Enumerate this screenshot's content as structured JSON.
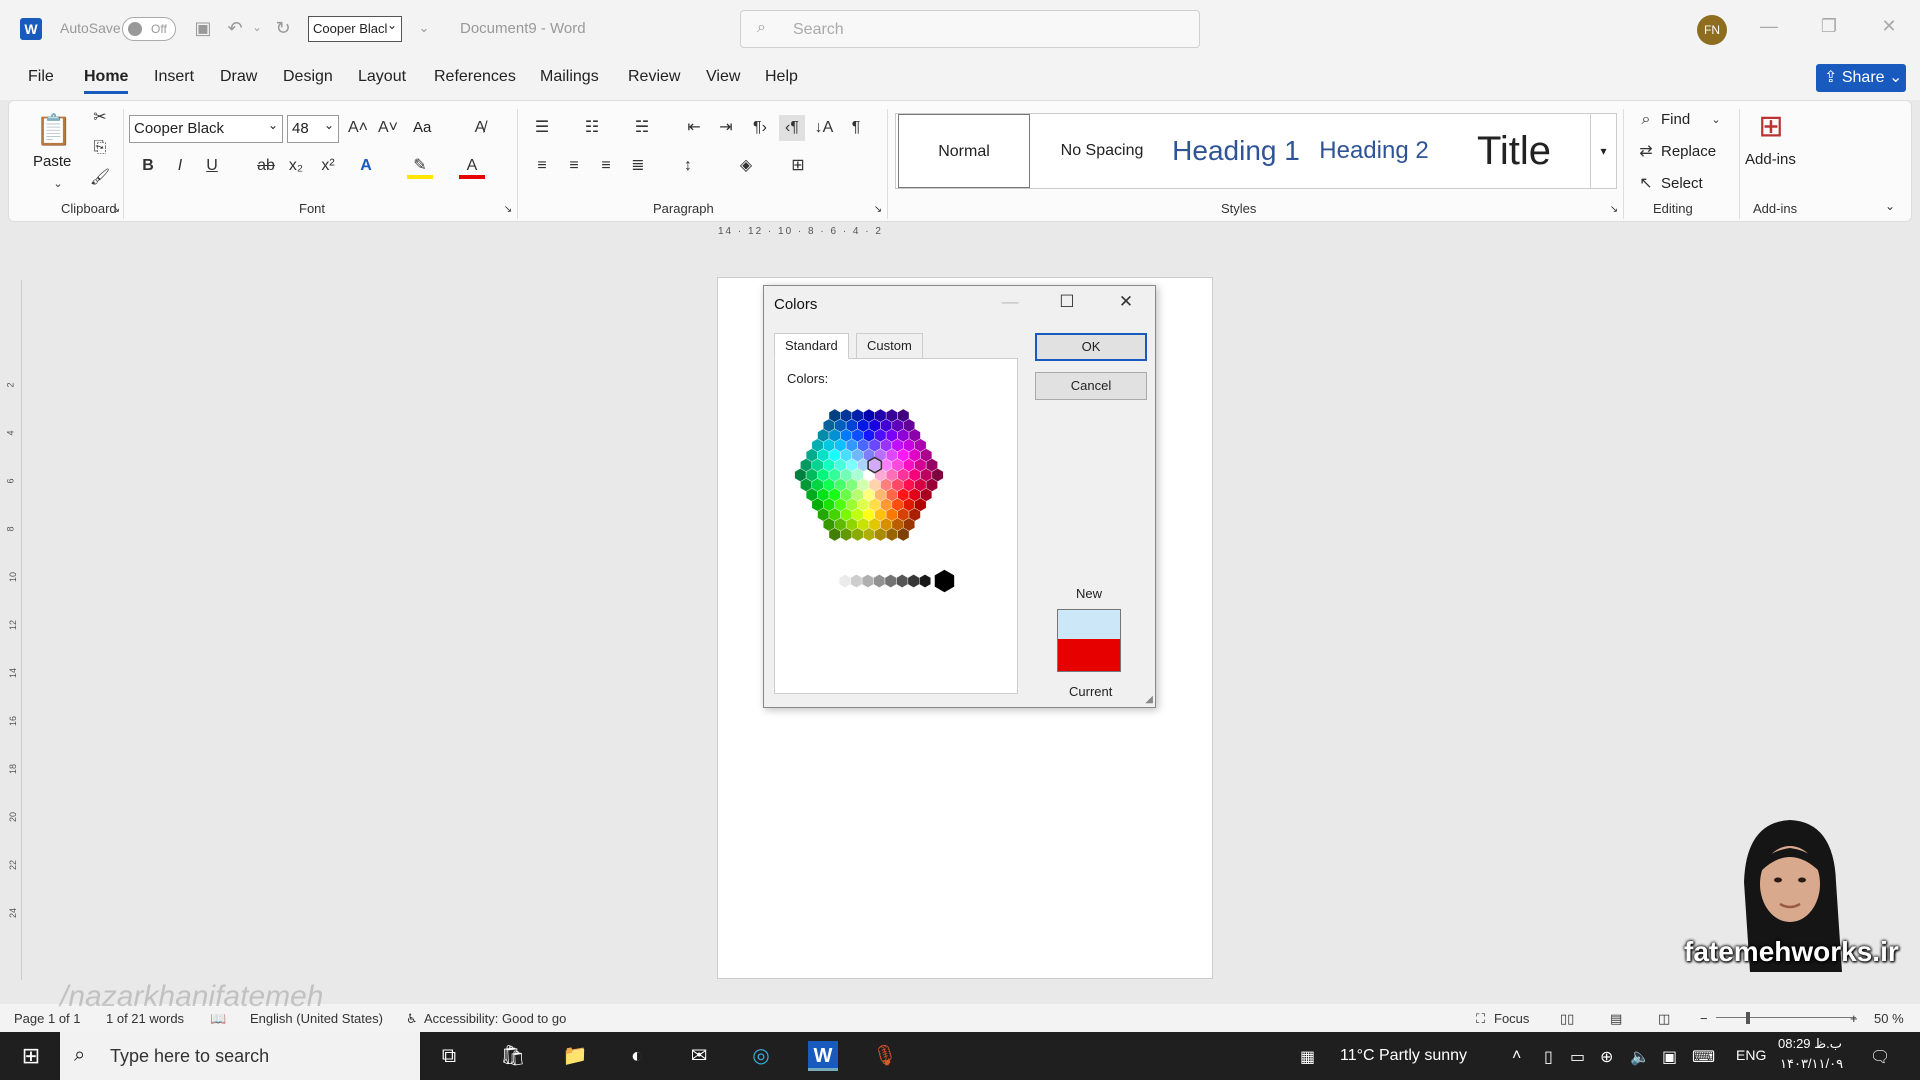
{
  "titlebar": {
    "autosave_label": "AutoSave",
    "toggle_state": "Off",
    "font_box": "Cooper Blacl",
    "doc_title": "Document9 - Word",
    "search_placeholder": "Search",
    "avatar_initials": "FN"
  },
  "menu": {
    "items": [
      "File",
      "Home",
      "Insert",
      "Draw",
      "Design",
      "Layout",
      "References",
      "Mailings",
      "Review",
      "View",
      "Help"
    ],
    "share_label": "Share"
  },
  "ribbon": {
    "clipboard": {
      "paste_label": "Paste",
      "group_label": "Clipboard"
    },
    "font": {
      "font_name": "Cooper Black",
      "font_size": "48",
      "case_label": "Aa",
      "group_label": "Font"
    },
    "paragraph": {
      "group_label": "Paragraph"
    },
    "styles": {
      "items": [
        "Normal",
        "No Spacing",
        "Heading 1",
        "Heading 2",
        "Title"
      ],
      "group_label": "Styles"
    },
    "editing": {
      "find_label": "Find",
      "replace_label": "Replace",
      "select_label": "Select",
      "group_label": "Editing"
    },
    "addins": {
      "button_label": "Add-ins",
      "group_label": "Add-ins"
    }
  },
  "ruler": {
    "horizontal_labels": "14 · 12 · 10 · 8 · 6 · 4 · 2",
    "vertical_labels": [
      "2",
      "4",
      "6",
      "8",
      "10",
      "12",
      "14",
      "16",
      "18",
      "20",
      "22",
      "24"
    ]
  },
  "dialog": {
    "title": "Colors",
    "tabs": [
      "Standard",
      "Custom"
    ],
    "colors_label": "Colors:",
    "ok_label": "OK",
    "cancel_label": "Cancel",
    "new_label": "New",
    "current_label": "Current",
    "new_color": "#cce8f8",
    "current_color": "#e60000"
  },
  "statusbar": {
    "page": "Page 1 of 1",
    "words": "1 of 21 words",
    "language": "English (United States)",
    "accessibility": "Accessibility: Good to go",
    "focus": "Focus",
    "zoom": "50 %"
  },
  "taskbar": {
    "search_placeholder": "Type here to search",
    "weather": "11°C  Partly sunny",
    "lang": "ENG",
    "time": "08:29 ب.ظ",
    "date": "۱۴۰۳/۱۱/۰۹"
  },
  "overlay": {
    "watermark": "/nazarkhanifatemeh",
    "brand": "fatemehworks.ir"
  },
  "colors": {
    "accent": "#185abd"
  }
}
